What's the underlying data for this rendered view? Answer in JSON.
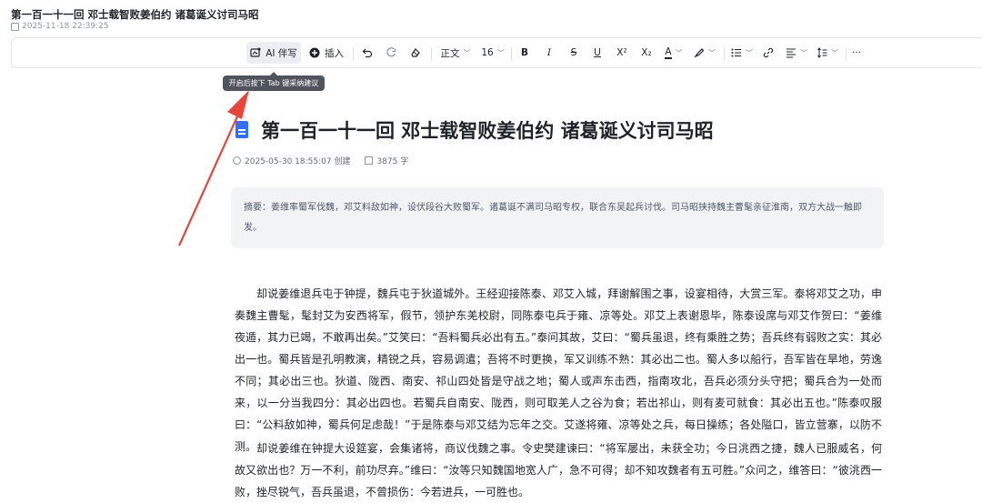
{
  "header": {
    "title": "第一百一十一回 邓士载智败姜伯约 诸葛诞义讨司马昭",
    "timestamp": "2025-11-18 22:39:25"
  },
  "toolbar": {
    "ai_label": "AI 伴写",
    "insert_label": "插入",
    "text_style": "正文",
    "font_size": "16",
    "bold": "B",
    "italic": "I",
    "strike": "S",
    "underline": "U",
    "superscript": "X²",
    "subscript": "X₂",
    "font_color": "A",
    "more": "···"
  },
  "tooltip": {
    "text": "开启后按下 Tab 键采纳建议"
  },
  "document": {
    "title": "第一百一十一回 邓士载智败姜伯约 诸葛诞义讨司马昭",
    "created": "2025-05-30 18:55:07 创建",
    "word_count": "3875 字",
    "summary": "摘要：姜维率蜀军伐魏，邓艾料敌如神，设伏段谷大败蜀军。诸葛诞不满司马昭专权，联合东吴起兵讨伐。司马昭挟持魏主曹髦亲征淮南，双方大战一触即发。",
    "paragraphs": [
      "却说姜维退兵屯于钟提，魏兵屯于狄道城外。王经迎接陈泰、邓艾入城，拜谢解围之事，设宴相待，大赏三军。泰将邓艾之功，申奏魏主曹髦，髦封艾为安西将军，假节，领护东羌校尉，同陈泰屯兵于雍、凉等处。邓艾上表谢恩毕，陈泰设席与邓艾作贺曰：“姜维夜遁，其力已竭，不敢再出矣。”艾笑曰：“吾料蜀兵必出有五。”泰问其故，艾曰：“蜀兵虽退，终有乘胜之势；吾兵终有弱败之实：其必出一也。蜀兵皆是孔明教演，精锐之兵，容易调遣；吾将不时更换，军又训练不熟：其必出二也。蜀人多以船行，吾军皆在旱地，劳逸不同；其必出三也。狄道、陇西、南安、祁山四处皆是守战之地；蜀人或声东击西，指南攻北，吾兵必须分头守把；蜀兵合为一处而来，以一分当我四分：其必出四也。若蜀兵自南安、陇西，则可取羌人之谷为食；若出祁山，则有麦可就食：其必出五也。”陈泰叹服曰：“公料敌如神，蜀兵何足虑哉！”于是陈泰与邓艾结为忘年之交。艾遂将雍、凉等处之兵，每日操练；各处隘口，皆立营寨，以防不测。",
      "却说姜维在钟提大设筵宴，会集诸将，商议伐魏之事。令史樊建谏曰：“将军屡出，未获全功；今日洮西之捷，魏人已服威名，何故又欲出也？万一不利，前功尽弃。”维曰：“汝等只知魏国地宽人广，急不可得；却不知攻魏者有五可胜。”众问之，维答曰：“彼洮西一败，挫尽锐气，吾兵虽退，不曾损伤：今若进兵，一可胜也。"
    ]
  },
  "colors": {
    "accent": "#3370ff",
    "arrow": "#e8453c",
    "summary_bg": "#f2f3f5",
    "tooltip_bg": "#50555d"
  },
  "icons": [
    "clock-icon",
    "ai-write-icon",
    "plus-circle-icon",
    "undo-icon",
    "redo-icon",
    "eraser-icon",
    "chevron-down-icon",
    "font-color-icon",
    "highlighter-icon",
    "bullet-list-icon",
    "link-icon",
    "align-left-icon",
    "line-height-icon",
    "more-icon",
    "document-icon",
    "word-count-icon",
    "annotation-arrow"
  ]
}
